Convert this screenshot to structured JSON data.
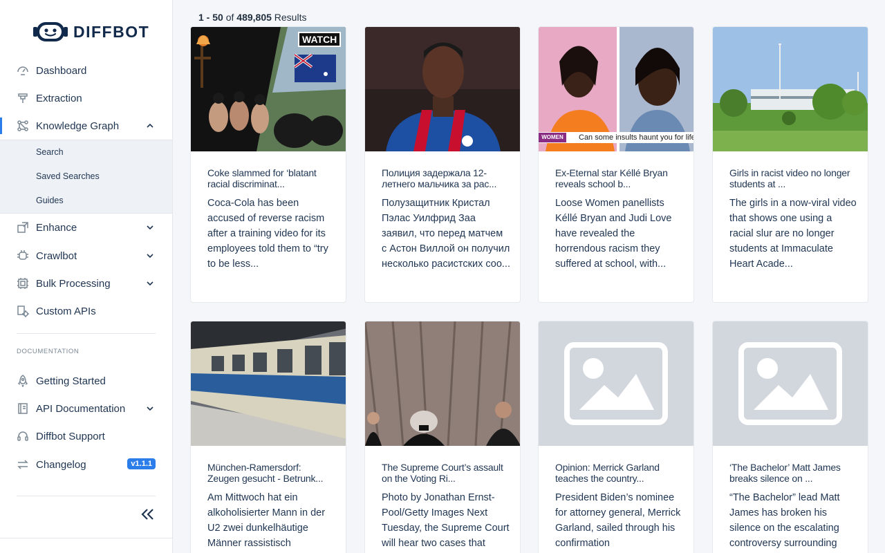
{
  "brand": {
    "name": "DIFFBOT"
  },
  "sidebar": {
    "items": [
      {
        "label": "Dashboard",
        "icon": "dashboard-icon"
      },
      {
        "label": "Extraction",
        "icon": "extraction-icon"
      },
      {
        "label": "Knowledge Graph",
        "icon": "knowledge-graph-icon",
        "expanded": true
      },
      {
        "label": "Enhance",
        "icon": "enhance-icon"
      },
      {
        "label": "Crawlbot",
        "icon": "crawlbot-icon"
      },
      {
        "label": "Bulk Processing",
        "icon": "bulk-processing-icon"
      },
      {
        "label": "Custom APIs",
        "icon": "custom-apis-icon"
      }
    ],
    "kg_subitems": [
      "Search",
      "Saved Searches",
      "Guides"
    ],
    "doc_section_title": "DOCUMENTATION",
    "doc_items": [
      {
        "label": "Getting Started",
        "icon": "rocket-icon"
      },
      {
        "label": "API Documentation",
        "icon": "book-icon"
      },
      {
        "label": "Diffbot Support",
        "icon": "headset-icon"
      },
      {
        "label": "Changelog",
        "icon": "swap-icon"
      }
    ],
    "version_badge": "v1.1.1"
  },
  "results": {
    "range": "1 - 50",
    "of": "of",
    "total": "489,805",
    "suffix": "Results"
  },
  "cards": [
    {
      "title": "Coke slammed for ‘blatant racial discriminat...",
      "desc": "Coca-Cola has been accused of reverse racism after a training video for its employees told them to “try to be less...",
      "image": "photo",
      "overlay": "WATCH"
    },
    {
      "title": "Полиция задержала 12-летнего мальчика за рас...",
      "desc": "Полузащитник Кристал Пэлас Уилфрид Заа заявил, что перед матчем с Астон Виллой он получил несколько расистских соо...",
      "image": "photo"
    },
    {
      "title": "Ex-Eternal star Kéllé Bryan reveals school b...",
      "desc": "Loose Women panellists Kéllé Bryan and Judi Love have revealed the horrendous racism they suffered at school, with...",
      "image": "photo",
      "caption": "Can some insults haunt you for life",
      "tag": "WOMEN"
    },
    {
      "title": "Girls in racist video no longer students at ...",
      "desc": "The girls in a now-viral video that shows one using a racial slur are no longer students at Immaculate Heart Acade...",
      "image": "photo"
    },
    {
      "title": "München-Ramersdorf: Zeugen gesucht - Betrunk...",
      "desc": "Am Mittwoch hat ein alkoholisierter Mann in der U2 zwei dunkelhäutige Männer rassistisch",
      "image": "photo"
    },
    {
      "title": "The Supreme Court’s assault on the Voting Ri...",
      "desc": "Photo by Jonathan Ernst-Pool/Getty Images Next Tuesday, the Supreme Court will hear two cases that",
      "image": "photo"
    },
    {
      "title": "Opinion: Merrick Garland teaches the country...",
      "desc": "President Biden’s nominee for attorney general, Merrick Garland, sailed through his confirmation",
      "image": "placeholder"
    },
    {
      "title": "‘The Bachelor’ Matt James breaks silence on ...",
      "desc": "“The Bachelor” lead Matt James has broken his silence on the escalating controversy surrounding",
      "image": "placeholder"
    }
  ]
}
